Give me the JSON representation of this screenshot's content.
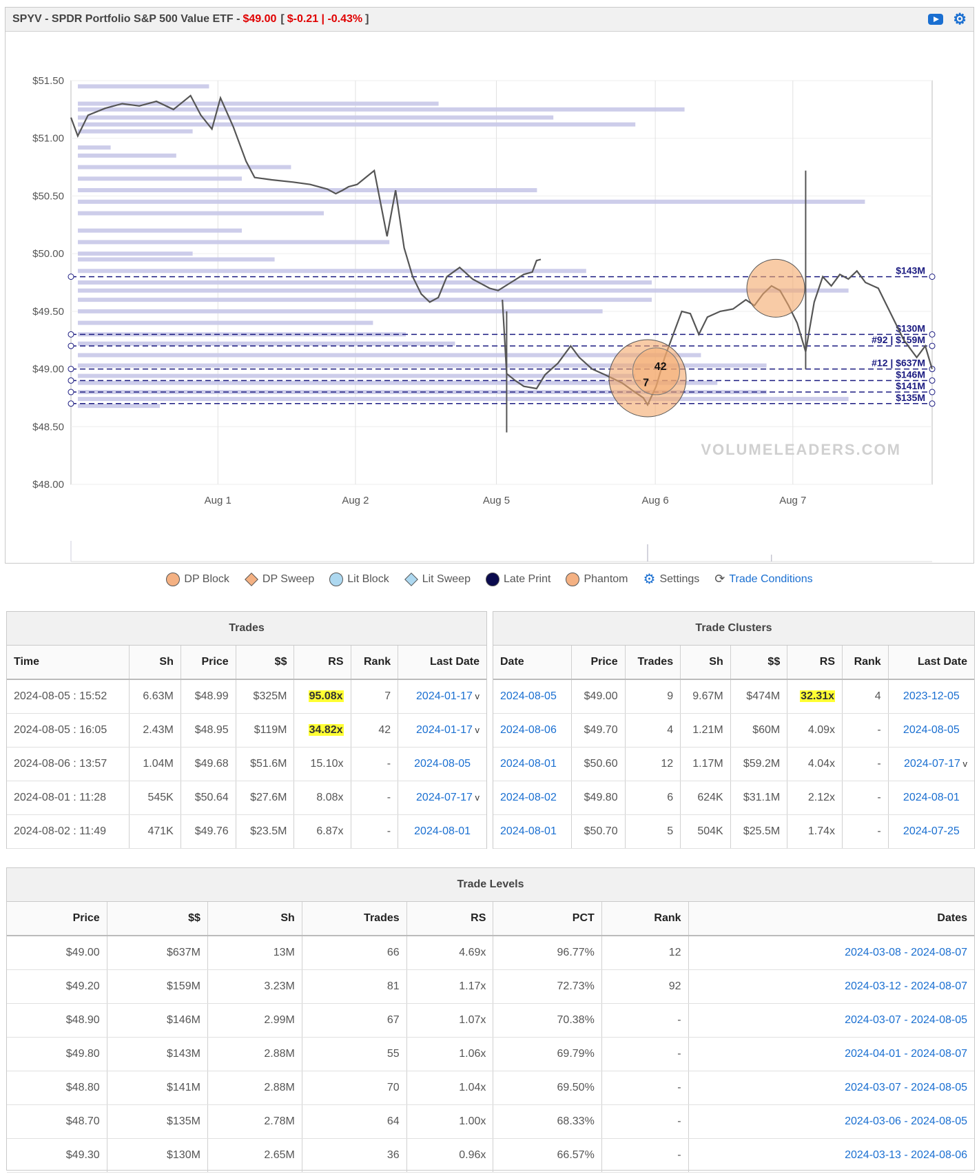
{
  "header": {
    "symbol_title": "SPYV - SPDR Portfolio S&P 500 Value ETF - ",
    "price": "$49.00",
    "change_open": "[",
    "change": "$-0.21 | -0.43%",
    "change_close": "]",
    "icons": [
      "youtube-icon",
      "gear-icon"
    ]
  },
  "chart_data": {
    "type": "line",
    "title": "",
    "watermark": "VOLUMELEADERS.COM",
    "y_ticks": [
      "$51.50",
      "$51.00",
      "$50.50",
      "$50.00",
      "$49.50",
      "$49.00",
      "$48.50",
      "$48.00"
    ],
    "ylim": [
      48.0,
      51.5
    ],
    "x_ticks": [
      "Aug 1",
      "Aug 2",
      "Aug 5",
      "Aug 6",
      "Aug 7"
    ],
    "series": [
      {
        "values": [
          [
            0.0,
            51.18
          ],
          [
            0.008,
            51.02
          ],
          [
            0.02,
            51.2
          ],
          [
            0.04,
            51.26
          ],
          [
            0.06,
            51.3
          ],
          [
            0.08,
            51.28
          ],
          [
            0.1,
            51.32
          ],
          [
            0.12,
            51.25
          ],
          [
            0.14,
            51.37
          ],
          [
            0.152,
            51.2
          ],
          [
            0.165,
            51.08
          ],
          [
            0.175,
            51.35
          ],
          [
            0.19,
            51.1
          ],
          [
            0.205,
            50.8
          ],
          [
            0.215,
            50.66
          ],
          [
            0.235,
            50.64
          ],
          [
            0.26,
            50.62
          ],
          [
            0.28,
            50.6
          ],
          [
            0.3,
            50.56
          ],
          [
            0.31,
            50.52
          ],
          [
            0.318,
            50.55
          ],
          [
            0.325,
            50.58
          ],
          [
            0.335,
            50.6
          ],
          [
            0.345,
            50.66
          ],
          [
            0.355,
            50.72
          ],
          [
            0.37,
            50.15
          ],
          [
            0.38,
            50.55
          ],
          [
            0.39,
            50.05
          ],
          [
            0.4,
            49.8
          ],
          [
            0.41,
            49.65
          ],
          [
            0.42,
            49.58
          ],
          [
            0.43,
            49.62
          ],
          [
            0.44,
            49.8
          ],
          [
            0.455,
            49.88
          ],
          [
            0.47,
            49.78
          ],
          [
            0.49,
            49.7
          ],
          [
            0.5,
            49.68
          ],
          [
            0.515,
            49.75
          ],
          [
            0.53,
            49.82
          ],
          [
            0.54,
            49.84
          ],
          [
            0.545,
            49.94
          ],
          [
            0.55,
            49.95
          ],
          [
            0.505,
            49.6
          ],
          [
            0.51,
            48.96
          ],
          [
            0.52,
            48.9
          ],
          [
            0.53,
            48.85
          ],
          [
            0.545,
            48.83
          ],
          [
            0.555,
            48.95
          ],
          [
            0.57,
            49.05
          ],
          [
            0.585,
            49.2
          ],
          [
            0.595,
            49.1
          ],
          [
            0.61,
            49.0
          ],
          [
            0.625,
            48.95
          ],
          [
            0.645,
            48.88
          ],
          [
            0.66,
            48.8
          ],
          [
            0.67,
            48.75
          ],
          [
            0.675,
            48.69
          ],
          [
            0.685,
            48.85
          ],
          [
            0.695,
            49.1
          ],
          [
            0.705,
            49.3
          ],
          [
            0.715,
            49.5
          ],
          [
            0.725,
            49.48
          ],
          [
            0.735,
            49.3
          ],
          [
            0.745,
            49.45
          ],
          [
            0.76,
            49.5
          ],
          [
            0.775,
            49.52
          ],
          [
            0.79,
            49.6
          ],
          [
            0.8,
            49.55
          ],
          [
            0.81,
            49.65
          ],
          [
            0.82,
            49.72
          ],
          [
            0.83,
            49.68
          ],
          [
            0.84,
            49.55
          ],
          [
            0.85,
            49.4
          ],
          [
            0.86,
            49.15
          ],
          [
            0.87,
            49.58
          ],
          [
            0.88,
            49.8
          ],
          [
            0.89,
            49.72
          ],
          [
            0.9,
            49.82
          ],
          [
            0.91,
            49.78
          ],
          [
            0.92,
            49.85
          ],
          [
            0.93,
            49.75
          ],
          [
            0.945,
            49.7
          ],
          [
            0.955,
            49.55
          ],
          [
            0.965,
            49.4
          ],
          [
            0.975,
            49.25
          ],
          [
            0.985,
            49.15
          ],
          [
            0.99,
            49.1
          ],
          [
            1.0,
            49.2
          ],
          [
            1.008,
            49.0
          ]
        ]
      }
    ],
    "levels": [
      {
        "price": 49.8,
        "label": "$143M"
      },
      {
        "price": 49.3,
        "label": "$130M"
      },
      {
        "price": 49.2,
        "label": "#92 | $159M"
      },
      {
        "price": 49.0,
        "label": "#12 | $637M"
      },
      {
        "price": 48.9,
        "label": "$146M"
      },
      {
        "price": 48.8,
        "label": "$141M"
      },
      {
        "price": 48.7,
        "label": "$135M"
      }
    ],
    "volume_profile": [
      {
        "price": 51.45,
        "length": 0.16
      },
      {
        "price": 51.3,
        "length": 0.44
      },
      {
        "price": 51.25,
        "length": 0.74
      },
      {
        "price": 51.18,
        "length": 0.58
      },
      {
        "price": 51.12,
        "length": 0.68
      },
      {
        "price": 51.06,
        "length": 0.14
      },
      {
        "price": 50.92,
        "length": 0.04
      },
      {
        "price": 50.85,
        "length": 0.12
      },
      {
        "price": 50.75,
        "length": 0.26
      },
      {
        "price": 50.65,
        "length": 0.2
      },
      {
        "price": 50.55,
        "length": 0.56
      },
      {
        "price": 50.45,
        "length": 0.96
      },
      {
        "price": 50.35,
        "length": 0.3
      },
      {
        "price": 50.2,
        "length": 0.2
      },
      {
        "price": 50.1,
        "length": 0.38
      },
      {
        "price": 50.0,
        "length": 0.14
      },
      {
        "price": 49.95,
        "length": 0.24
      },
      {
        "price": 49.85,
        "length": 0.62
      },
      {
        "price": 49.75,
        "length": 0.7
      },
      {
        "price": 49.68,
        "length": 0.94
      },
      {
        "price": 49.6,
        "length": 0.7
      },
      {
        "price": 49.5,
        "length": 0.64
      },
      {
        "price": 49.4,
        "length": 0.36
      },
      {
        "price": 49.3,
        "length": 0.4
      },
      {
        "price": 49.22,
        "length": 0.46
      },
      {
        "price": 49.12,
        "length": 0.76
      },
      {
        "price": 49.03,
        "length": 0.84
      },
      {
        "price": 48.94,
        "length": 0.68
      },
      {
        "price": 48.88,
        "length": 0.78
      },
      {
        "price": 48.8,
        "length": 0.84
      },
      {
        "price": 48.74,
        "length": 0.94
      },
      {
        "price": 48.68,
        "length": 0.1
      }
    ],
    "phantom_markers": [
      {
        "price": 49.0,
        "rank_label": "42"
      },
      {
        "price": 48.88,
        "rank_label": "7"
      }
    ],
    "dp_block_markers": [
      {
        "price": 49.7
      }
    ]
  },
  "legend": [
    {
      "label": "DP Block",
      "shape": "circle",
      "color": "#f4b183"
    },
    {
      "label": "DP Sweep",
      "shape": "diamond",
      "color": "#f4b183"
    },
    {
      "label": "Lit Block",
      "shape": "circle",
      "color": "#add8f0"
    },
    {
      "label": "Lit Sweep",
      "shape": "diamond",
      "color": "#add8f0"
    },
    {
      "label": "Late Print",
      "shape": "circle",
      "color": "#0b0b4e"
    },
    {
      "label": "Phantom",
      "shape": "phantom",
      "color": "#f4b183"
    },
    {
      "label": "Settings",
      "shape": "gear",
      "color": "#1a6fd1"
    },
    {
      "label": "Trade Conditions",
      "shape": "cycle",
      "color": "#1a6fd1",
      "link": true
    }
  ],
  "trades": {
    "title": "Trades",
    "columns": [
      "Time",
      "Sh",
      "Price",
      "$$",
      "RS",
      "Rank",
      "Last Date"
    ],
    "rows": [
      {
        "time": "2024-08-05 : 15:52",
        "sh": "6.63M",
        "price": "$48.99",
        "dollars": "$325M",
        "rs": "95.08x",
        "rs_hl": true,
        "rank": "7",
        "last_date": "2024-01-17",
        "v": "v"
      },
      {
        "time": "2024-08-05 : 16:05",
        "sh": "2.43M",
        "price": "$48.95",
        "dollars": "$119M",
        "rs": "34.82x",
        "rs_hl": true,
        "rank": "42",
        "last_date": "2024-01-17",
        "v": "v"
      },
      {
        "time": "2024-08-06 : 13:57",
        "sh": "1.04M",
        "price": "$49.68",
        "dollars": "$51.6M",
        "rs": "15.10x",
        "rs_hl": false,
        "rank": "-",
        "last_date": "2024-08-05",
        "v": ""
      },
      {
        "time": "2024-08-01 : 11:28",
        "sh": "545K",
        "price": "$50.64",
        "dollars": "$27.6M",
        "rs": "8.08x",
        "rs_hl": false,
        "rank": "-",
        "last_date": "2024-07-17",
        "v": "v"
      },
      {
        "time": "2024-08-02 : 11:49",
        "sh": "471K",
        "price": "$49.76",
        "dollars": "$23.5M",
        "rs": "6.87x",
        "rs_hl": false,
        "rank": "-",
        "last_date": "2024-08-01",
        "v": ""
      }
    ]
  },
  "clusters": {
    "title": "Trade Clusters",
    "columns": [
      "Date",
      "Price",
      "Trades",
      "Sh",
      "$$",
      "RS",
      "Rank",
      "Last Date"
    ],
    "rows": [
      {
        "date": "2024-08-05",
        "price": "$49.00",
        "trades": "9",
        "sh": "9.67M",
        "dollars": "$474M",
        "rs": "32.31x",
        "rs_hl": true,
        "rank": "4",
        "last_date": "2023-12-05",
        "v": ""
      },
      {
        "date": "2024-08-06",
        "price": "$49.70",
        "trades": "4",
        "sh": "1.21M",
        "dollars": "$60M",
        "rs": "4.09x",
        "rs_hl": false,
        "rank": "-",
        "last_date": "2024-08-05",
        "v": ""
      },
      {
        "date": "2024-08-01",
        "price": "$50.60",
        "trades": "12",
        "sh": "1.17M",
        "dollars": "$59.2M",
        "rs": "4.04x",
        "rs_hl": false,
        "rank": "-",
        "last_date": "2024-07-17",
        "v": "v"
      },
      {
        "date": "2024-08-02",
        "price": "$49.80",
        "trades": "6",
        "sh": "624K",
        "dollars": "$31.1M",
        "rs": "2.12x",
        "rs_hl": false,
        "rank": "-",
        "last_date": "2024-08-01",
        "v": ""
      },
      {
        "date": "2024-08-01",
        "price": "$50.70",
        "trades": "5",
        "sh": "504K",
        "dollars": "$25.5M",
        "rs": "1.74x",
        "rs_hl": false,
        "rank": "-",
        "last_date": "2024-07-25",
        "v": ""
      }
    ]
  },
  "levels_table": {
    "title": "Trade Levels",
    "columns": [
      "Price",
      "$$",
      "Sh",
      "Trades",
      "RS",
      "PCT",
      "Rank",
      "Dates"
    ],
    "rows": [
      {
        "price": "$49.00",
        "dollars": "$637M",
        "sh": "13M",
        "trades": "66",
        "rs": "4.69x",
        "pct": "96.77%",
        "rank": "12",
        "dates": "2024-03-08 - 2024-08-07"
      },
      {
        "price": "$49.20",
        "dollars": "$159M",
        "sh": "3.23M",
        "trades": "81",
        "rs": "1.17x",
        "pct": "72.73%",
        "rank": "92",
        "dates": "2024-03-12 - 2024-08-07"
      },
      {
        "price": "$48.90",
        "dollars": "$146M",
        "sh": "2.99M",
        "trades": "67",
        "rs": "1.07x",
        "pct": "70.38%",
        "rank": "-",
        "dates": "2024-03-07 - 2024-08-05"
      },
      {
        "price": "$49.80",
        "dollars": "$143M",
        "sh": "2.88M",
        "trades": "55",
        "rs": "1.06x",
        "pct": "69.79%",
        "rank": "-",
        "dates": "2024-04-01 - 2024-08-07"
      },
      {
        "price": "$48.80",
        "dollars": "$141M",
        "sh": "2.88M",
        "trades": "70",
        "rs": "1.04x",
        "pct": "69.50%",
        "rank": "-",
        "dates": "2024-03-07 - 2024-08-05"
      },
      {
        "price": "$48.70",
        "dollars": "$135M",
        "sh": "2.78M",
        "trades": "64",
        "rs": "1.00x",
        "pct": "68.33%",
        "rank": "-",
        "dates": "2024-03-06 - 2024-08-05"
      },
      {
        "price": "$49.30",
        "dollars": "$130M",
        "sh": "2.65M",
        "trades": "36",
        "rs": "0.96x",
        "pct": "66.57%",
        "rank": "-",
        "dates": "2024-03-13 - 2024-08-06"
      }
    ]
  }
}
